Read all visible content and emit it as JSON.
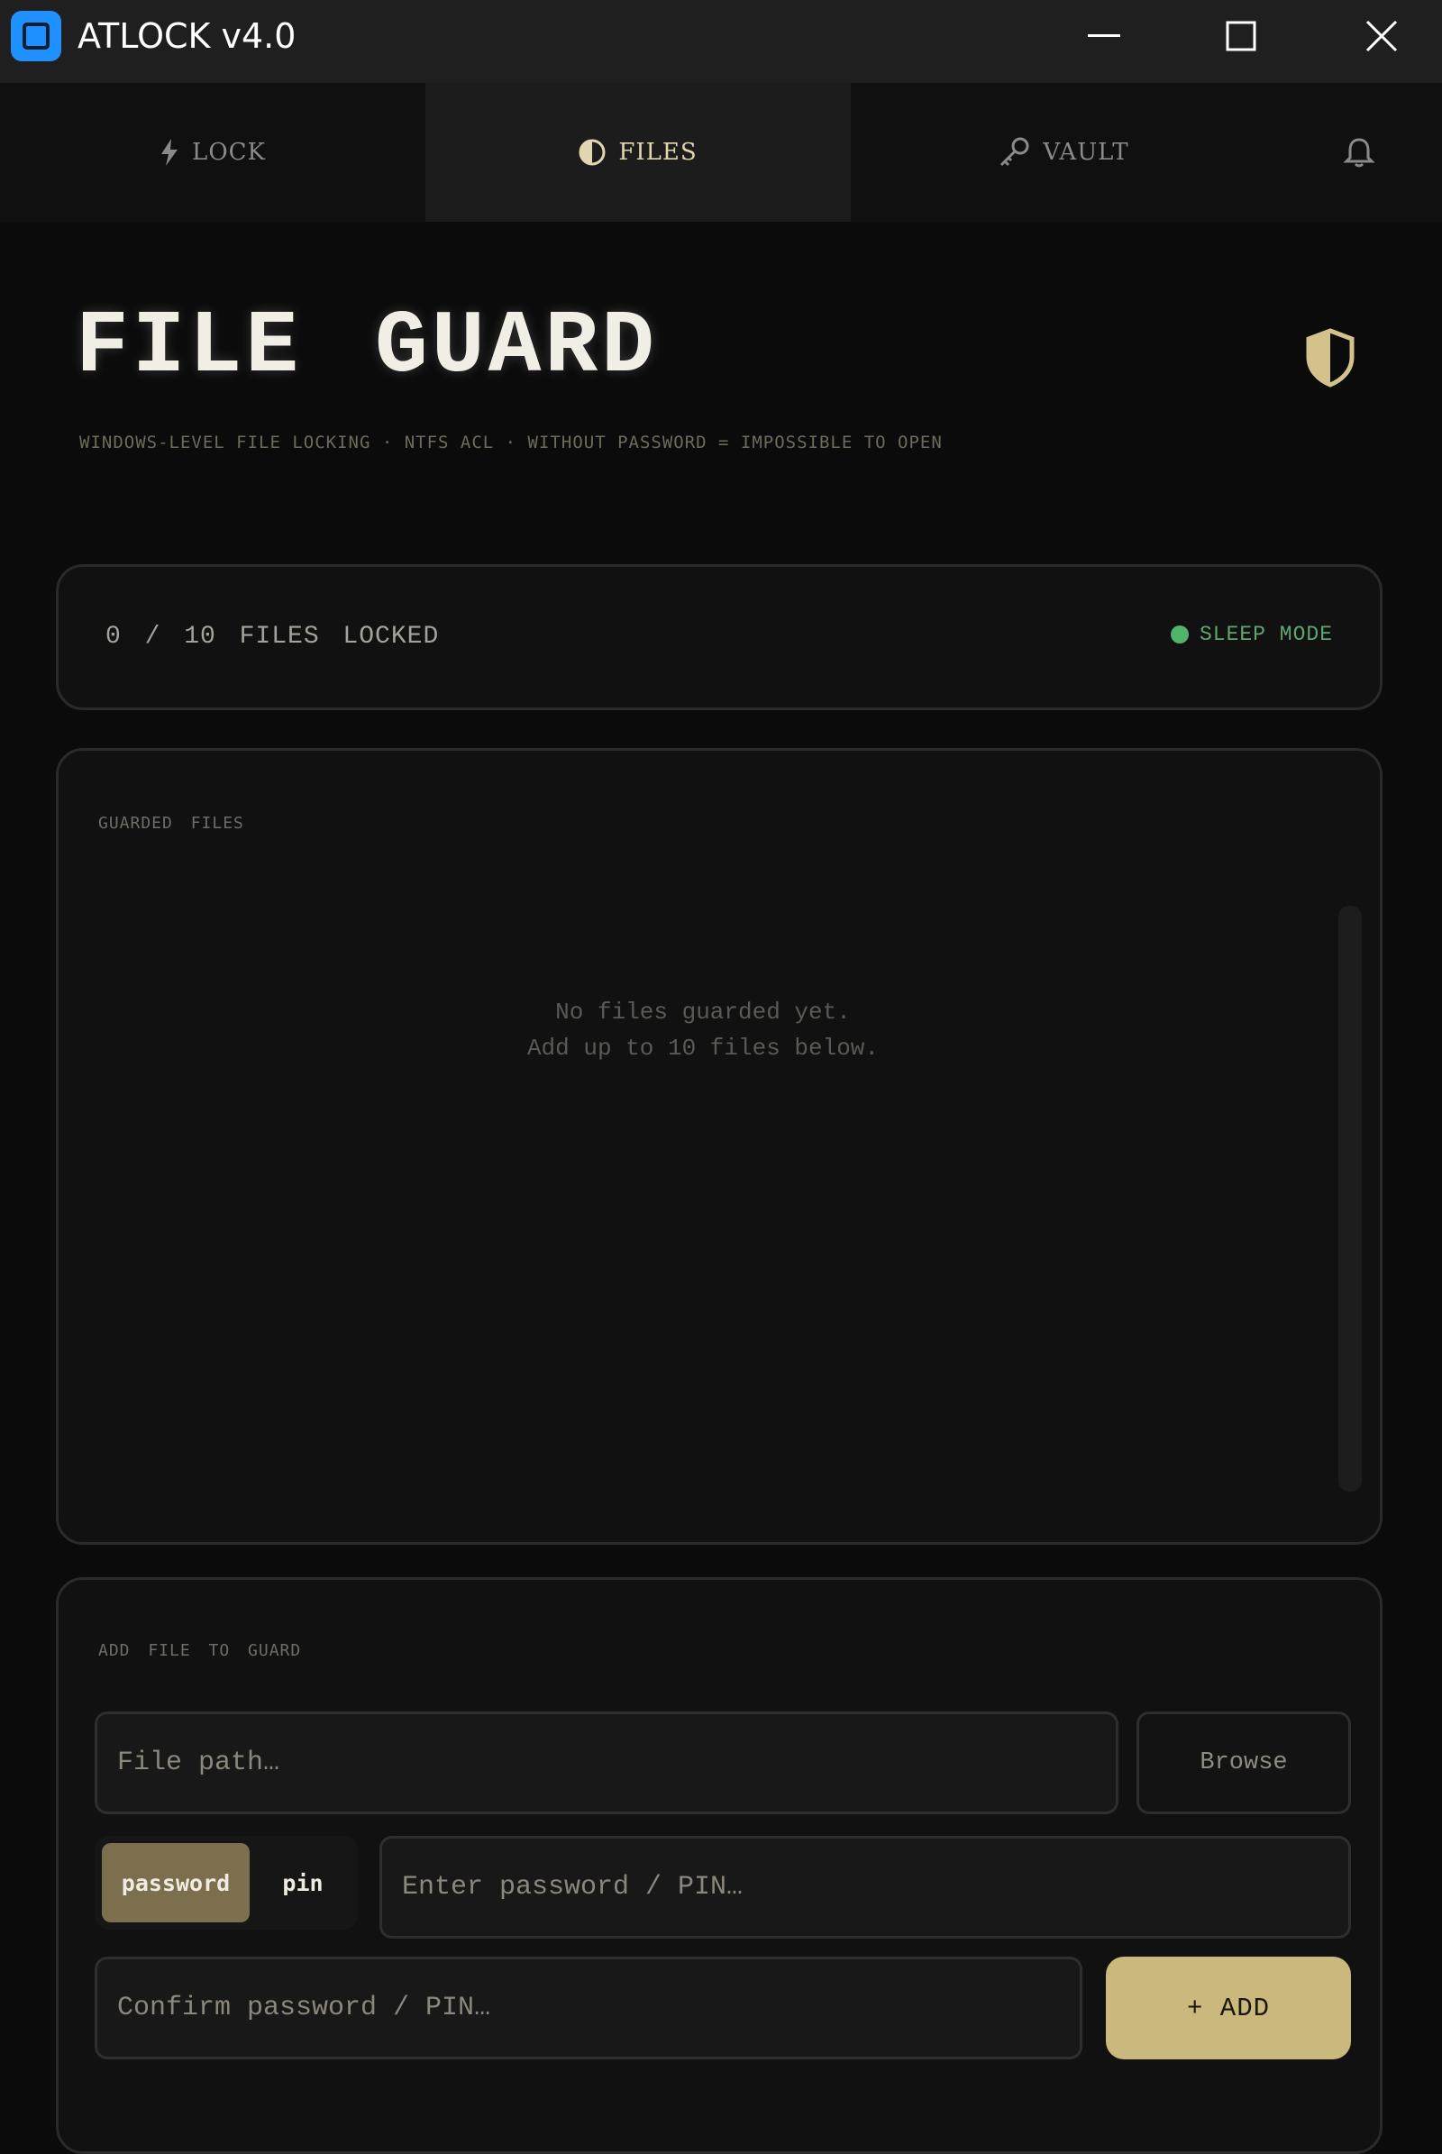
{
  "window": {
    "title": "ATLOCK  v4.0"
  },
  "tabs": [
    {
      "label": "LOCK",
      "icon": "lightning-icon",
      "active": false
    },
    {
      "label": "FILES",
      "icon": "half-shield-icon",
      "active": true
    },
    {
      "label": "VAULT",
      "icon": "key-icon",
      "active": false
    }
  ],
  "header": {
    "title": "FILE  GUARD",
    "subtitle": "WINDOWS-LEVEL  FILE  LOCKING  ·  NTFS ACL  ·  WITHOUT PASSWORD = IMPOSSIBLE TO OPEN"
  },
  "status": {
    "count_text": "0 / 10  FILES  LOCKED",
    "mode_label": "SLEEP MODE",
    "mode_color": "#52b36a"
  },
  "guarded_files": {
    "section_label": "GUARDED  FILES",
    "empty_line1": "No files guarded yet.",
    "empty_line2": "Add up to 10 files below."
  },
  "add_file": {
    "section_label": "ADD  FILE  TO  GUARD",
    "path_placeholder": "File path…",
    "browse_label": "Browse",
    "mode_options": [
      "password",
      "pin"
    ],
    "selected_mode": "password",
    "password_placeholder": "Enter password / PIN…",
    "confirm_placeholder": "Confirm password / PIN…",
    "add_label": "+ ADD"
  },
  "colors": {
    "accent": "#cbb87c",
    "active_toggle": "#7b6f4d",
    "background": "#0b0b0b"
  }
}
